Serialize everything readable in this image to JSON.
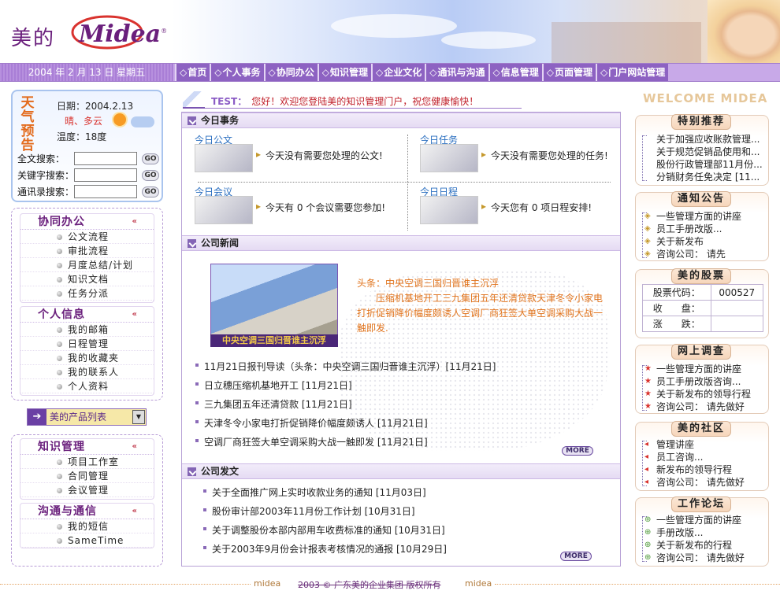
{
  "header": {
    "brand_cn": "美的",
    "brand_en": "Midea",
    "brand_reg": "®"
  },
  "date_bar": "2004 年 2 月 13 日  星期五",
  "nav": [
    "首页",
    "个人事务",
    "协同办公",
    "知识管理",
    "企业文化",
    "通讯与沟通",
    "信息管理",
    "页面管理",
    "门户网站管理"
  ],
  "weather": {
    "title": "天气预告",
    "date": "日期：2004.2.13",
    "condition": "晴、多云",
    "temperature": "温度：18度"
  },
  "search": [
    {
      "label": "全文搜索：",
      "go": "GO"
    },
    {
      "label": "关键字搜索：",
      "go": "GO"
    },
    {
      "label": "通讯录搜索：",
      "go": "GO"
    }
  ],
  "panels": {
    "collab": {
      "title": "协同办公",
      "items": [
        "公文流程",
        "审批流程",
        "月度总结/计划",
        "知识文档",
        "任务分派"
      ]
    },
    "personal": {
      "title": "个人信息",
      "items": [
        "我的邮箱",
        "日程管理",
        "我的收藏夹",
        "我的联系人",
        "个人资料"
      ]
    },
    "knowledge": {
      "title": "知识管理",
      "items": [
        "项目工作室",
        "合同管理",
        "会议管理"
      ]
    },
    "comm": {
      "title": "沟通与通信",
      "items": [
        "我的短信",
        "SameTime"
      ]
    }
  },
  "product_select": "美的产品列表",
  "test_bar": {
    "prefix": "TEST：",
    "text": "您好！欢迎您登陆美的知识管理门户，祝您健康愉快！"
  },
  "today": {
    "title": "今日事务",
    "items": [
      {
        "title": "今日公文",
        "text": "今天没有需要您处理的公文!"
      },
      {
        "title": "今日任务",
        "text": "今天没有需要您处理的任务!"
      },
      {
        "title": "今日会议",
        "text": "今天有 0 个会议需要您参加!"
      },
      {
        "title": "今日日程",
        "text": "今天您有 0 项日程安排!"
      }
    ]
  },
  "company_news": {
    "title": "公司新闻",
    "photo_caption": "中央空调三国归晋谁主沉浮",
    "headline_title": "头条：中央空调三国归晋谁主沉浮",
    "headline_body": "压缩机基地开工三九集团五年还清贷款天津冬令小家电打折促销降价幅度颇诱人空调厂商狂签大单空调采购大战一触即发.",
    "items": [
      "11月21日报刊导读（头条：中央空调三国归晋谁主沉浮）[11月21日]",
      "日立穗压缩机基地开工 [11月21日]",
      "三九集团五年还清贷款 [11月21日]",
      "天津冬令小家电打折促销降价幅度颇诱人 [11月21日]",
      "空调厂商狂签大单空调采购大战一触即发 [11月21日]"
    ],
    "more": "MORE"
  },
  "company_docs": {
    "title": "公司发文",
    "items": [
      "关于全面推广网上实时收款业务的通知 [11月03日]",
      "股份审计部2003年11月份工作计划 [10月31日]",
      "关于调整股份本部内部用车收费标准的通知 [10月31日]",
      "关于2003年9月份会计报表考核情况的通报 [10月29日]"
    ],
    "more": "MORE"
  },
  "right": {
    "welcome_a": "WELCOME ",
    "welcome_b": "MIDEA",
    "special": {
      "title": "特别推荐",
      "items": [
        "关于加强应收账款管理...",
        "关于规范促销品使用和...",
        "股份行政管理部11月份...",
        "分销财务任免决定 [11..."
      ]
    },
    "notice": {
      "title": "通知公告",
      "items": [
        "一些管理方面的讲座",
        "员工手册改版...",
        "关于新发布",
        "咨询公司： 请先"
      ]
    },
    "stock": {
      "title": "美的股票",
      "rows": [
        [
          "股票代码：",
          "000527"
        ],
        [
          "收　　盘：",
          ""
        ],
        [
          "涨　　跌：",
          ""
        ]
      ]
    },
    "survey": {
      "title": "网上调查",
      "items": [
        "一些管理方面的讲座",
        "员工手册改版咨询...",
        "关于新发布的领导行程",
        "咨询公司： 请先做好"
      ]
    },
    "community": {
      "title": "美的社区",
      "items": [
        "管理讲座",
        "员工咨询...",
        "新发布的领导行程",
        "咨询公司： 请先做好"
      ]
    },
    "forum": {
      "title": "工作论坛",
      "items": [
        "一些管理方面的讲座",
        "手册改版...",
        "关于新发布的行程",
        "咨询公司： 请先做好"
      ]
    }
  },
  "footer": {
    "left": "midea",
    "copyright": "2003 © 广东美的企业集团 版权所有",
    "right": "midea"
  },
  "colors": {
    "brand_purple": "#6a1f7c",
    "nav_purple": "#8d62c2",
    "accent_orange": "#e0731c"
  }
}
